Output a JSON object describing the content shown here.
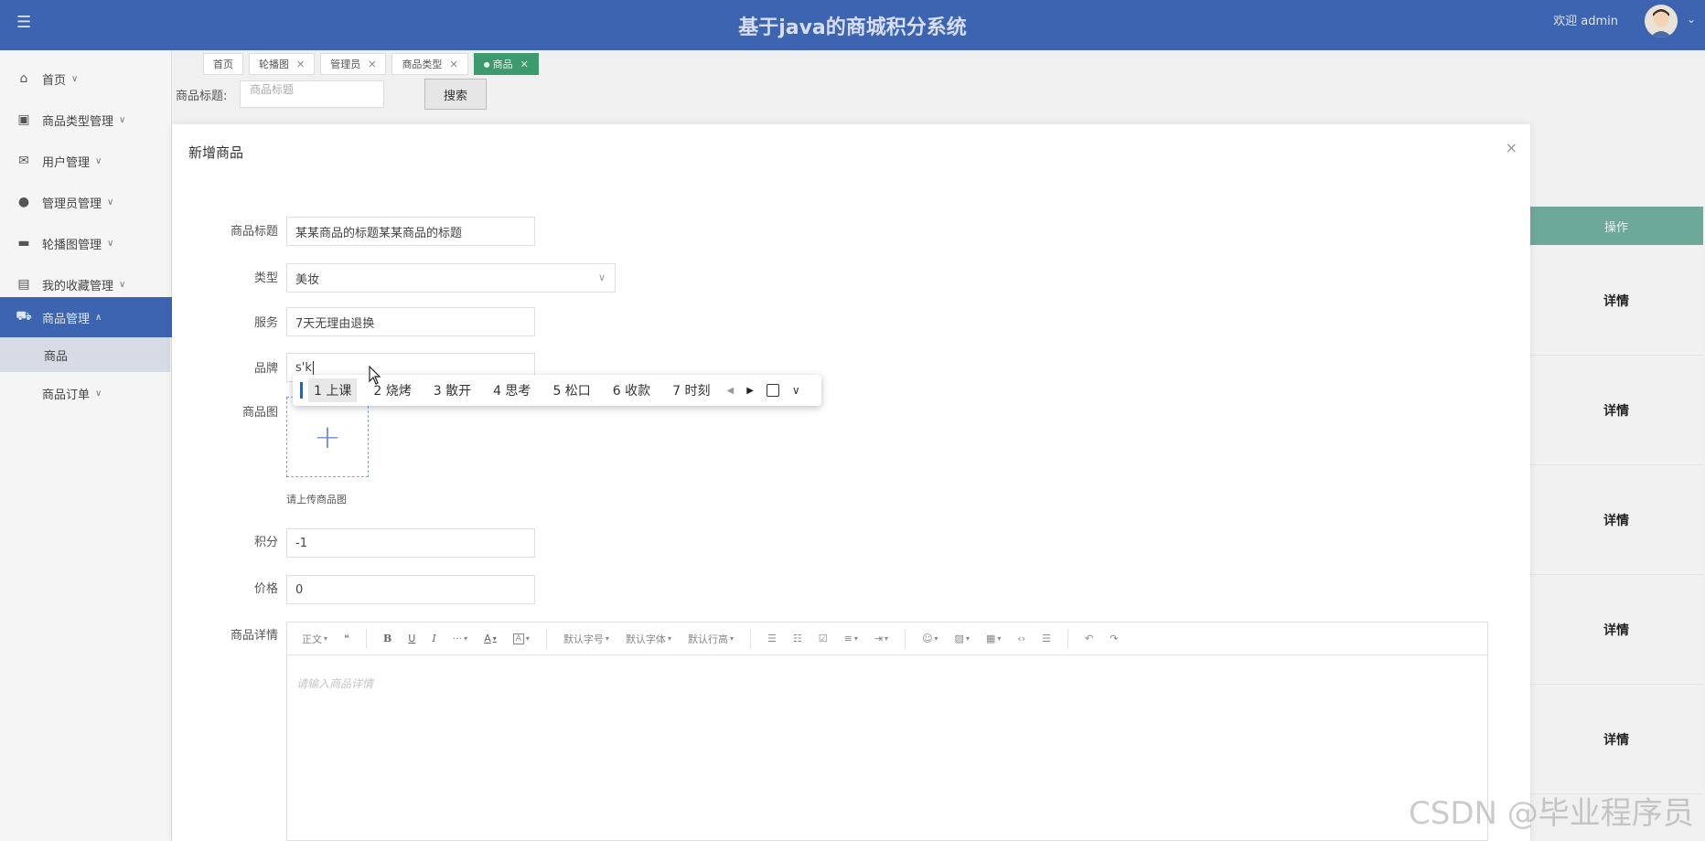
{
  "header": {
    "title": "基于java的商城积分系统",
    "welcome": "欢迎 admin",
    "menu_icon": "hamburger-icon",
    "caret": "⌄"
  },
  "sidebar": {
    "items": [
      {
        "label": "首页",
        "icon": "home-icon"
      },
      {
        "label": "商品类型管理",
        "icon": "category-icon"
      },
      {
        "label": "用户管理",
        "icon": "user-icon"
      },
      {
        "label": "管理员管理",
        "icon": "admin-icon"
      },
      {
        "label": "轮播图管理",
        "icon": "carousel-icon"
      },
      {
        "label": "我的收藏管理",
        "icon": "favorite-icon"
      },
      {
        "label": "商品管理",
        "icon": "goods-icon"
      }
    ],
    "sub_items": [
      {
        "label": "商品"
      },
      {
        "label": "商品订单"
      }
    ]
  },
  "tabs": [
    {
      "label": "首页"
    },
    {
      "label": "轮播图"
    },
    {
      "label": "管理员"
    },
    {
      "label": "商品类型"
    },
    {
      "label": "商品"
    }
  ],
  "search": {
    "label": "商品标题:",
    "placeholder": "商品标题",
    "button": "搜索"
  },
  "table": {
    "op_header": "操作",
    "rows": [
      {
        "action": "详情"
      },
      {
        "action": "详情"
      },
      {
        "action": "详情"
      },
      {
        "action": "详情"
      },
      {
        "action": "详情"
      }
    ]
  },
  "modal": {
    "title": "新增商品",
    "close": "×",
    "fields": {
      "title_label": "商品标题",
      "title_value": "某某商品的标题某某商品的标题",
      "type_label": "类型",
      "type_value": "美妆",
      "service_label": "服务",
      "service_value": "7天无理由退换",
      "brand_label": "品牌",
      "brand_value": "s'k",
      "image_label": "商品图",
      "image_hint": "请上传商品图",
      "points_label": "积分",
      "points_value": "-1",
      "price_label": "价格",
      "price_value": "0",
      "detail_label": "商品详情",
      "detail_placeholder": "请输入商品详情"
    }
  },
  "ime": {
    "candidates": [
      "1 上课",
      "2 烧烤",
      "3 散开",
      "4 思考",
      "5 松口",
      "6 收款",
      "7 时刻"
    ]
  },
  "editor": {
    "toolbar": {
      "paragraph": "正文",
      "quote": "❝",
      "bold": "B",
      "underline": "U",
      "italic": "I",
      "more": "···",
      "font_color": "A",
      "bg_color": "A",
      "font_size": "默认字号",
      "font_family": "默认字体",
      "line_height": "默认行高"
    }
  },
  "watermark": "CSDN @毕业程序员",
  "colors": {
    "brand": "#3c64b1",
    "active_tab": "#3c9a6e",
    "table_header": "#6ca99a"
  }
}
